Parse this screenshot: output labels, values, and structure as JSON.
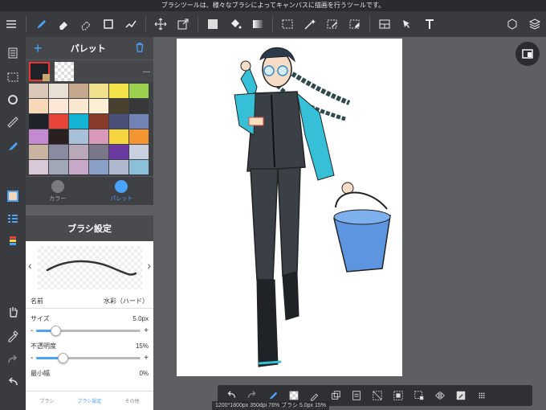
{
  "top_hint": "ブラシツールは、様々なブラシによってキャンバスに描画を行うツールです。",
  "palette": {
    "title": "パレット",
    "current_value": "---",
    "colors": [
      "#d9c8b8",
      "#e8e0d4",
      "#c6a88e",
      "#f0e08e",
      "#f4e24a",
      "#9bd14e",
      "#f7d8b8",
      "#fde8d8",
      "#fbe8d0",
      "#fbefd4",
      "#4a4030",
      "#383838",
      "#1e2229",
      "#e8443a",
      "#13b4d4",
      "#8a3a2a",
      "#4a5078",
      "#7083b4",
      "#c48ad0",
      "#2a2020",
      "#a8c0d8",
      "#d89ab8",
      "#f5d640",
      "#f39632",
      "#c8b4a0",
      "#8a8aa0",
      "#b8a8b8",
      "#7a7888",
      "#6a3aa0",
      "#c8d0e0",
      "#d8c8d8",
      "#a0a8b8",
      "#c8a8c8",
      "#8aa0c8",
      "#b0b8d0",
      "#8ac0d8"
    ],
    "tab_color": "カラー",
    "tab_palette": "パレット"
  },
  "brush": {
    "title": "ブラシ設定",
    "name_label": "名前",
    "name_value": "水彩（ハード）",
    "size_label": "サイズ",
    "size_value": "5.0px",
    "size_level": 0.18,
    "opacity_label": "不透明度",
    "opacity_value": "15%",
    "opacity_level": 0.25,
    "min_label": "最小幅",
    "min_value": "0%",
    "tabs": [
      "ブラシ",
      "ブラシ設定",
      "その他"
    ]
  },
  "status_text": "1200*1800px 350dpi 76% ブラシ 5.0px 15%",
  "accent": "#4aa3ff"
}
